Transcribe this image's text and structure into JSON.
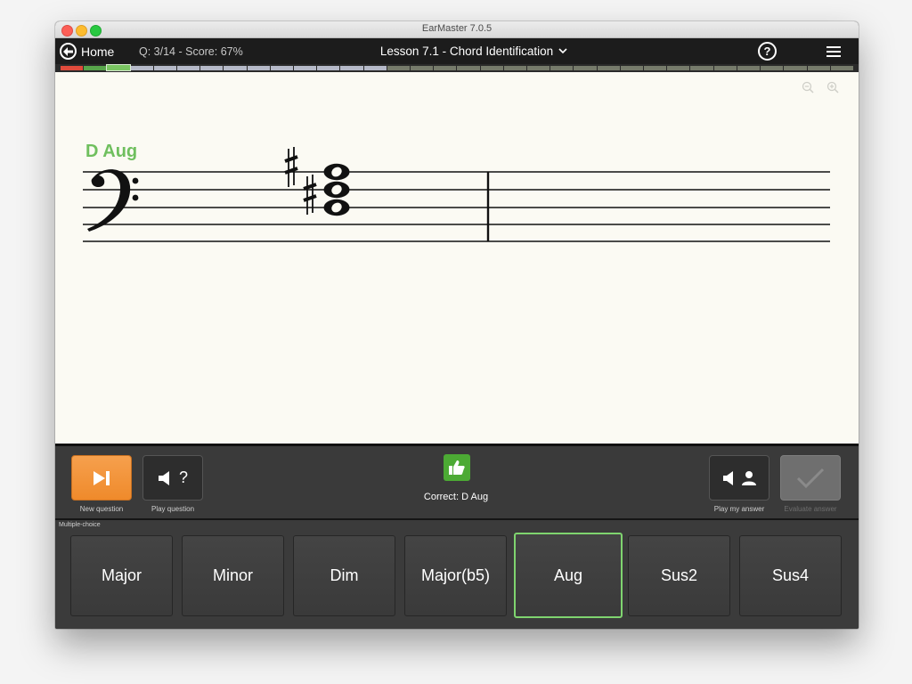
{
  "window": {
    "title": "EarMaster 7.0.5"
  },
  "header": {
    "home_label": "Home",
    "status": "Q: 3/14 - Score: 67%",
    "lesson_title": "Lesson 7.1 - Chord Identification",
    "help_icon": "help-circle-icon",
    "menu_icon": "hamburger-menu-icon"
  },
  "progress": {
    "segments": [
      "wrong",
      "correct",
      "current",
      "pending",
      "pending",
      "pending",
      "pending",
      "pending",
      "pending",
      "pending",
      "pending",
      "pending",
      "pending",
      "pending",
      "pending",
      "pending",
      "pending",
      "pending",
      "pending",
      "pending",
      "pending",
      "pending",
      "pending",
      "pending",
      "pending",
      "pending",
      "pending",
      "pending",
      "pending",
      "pending",
      "pending",
      "pending",
      "pending",
      "pending"
    ]
  },
  "score": {
    "chord_label": "D Aug",
    "clef": "bass",
    "notes": [
      "D",
      "F#",
      "A#"
    ]
  },
  "controls": {
    "new_question_label": "New question",
    "play_question_label": "Play question",
    "play_question_text": "?",
    "feedback_text": "Correct: D Aug",
    "play_my_answer_label": "Play my answer",
    "evaluate_answer_label": "Evaluate answer"
  },
  "choices": {
    "section_label": "Multiple-choice",
    "options": [
      "Major",
      "Minor",
      "Dim",
      "Major(b5)",
      "Aug",
      "Sus2",
      "Sus4"
    ],
    "selected": "Aug"
  },
  "colors": {
    "accent_orange": "#f19a43",
    "correct_green": "#4caa34",
    "selected_border": "#7fd46f",
    "chord_label_green": "#6fbf5e"
  }
}
